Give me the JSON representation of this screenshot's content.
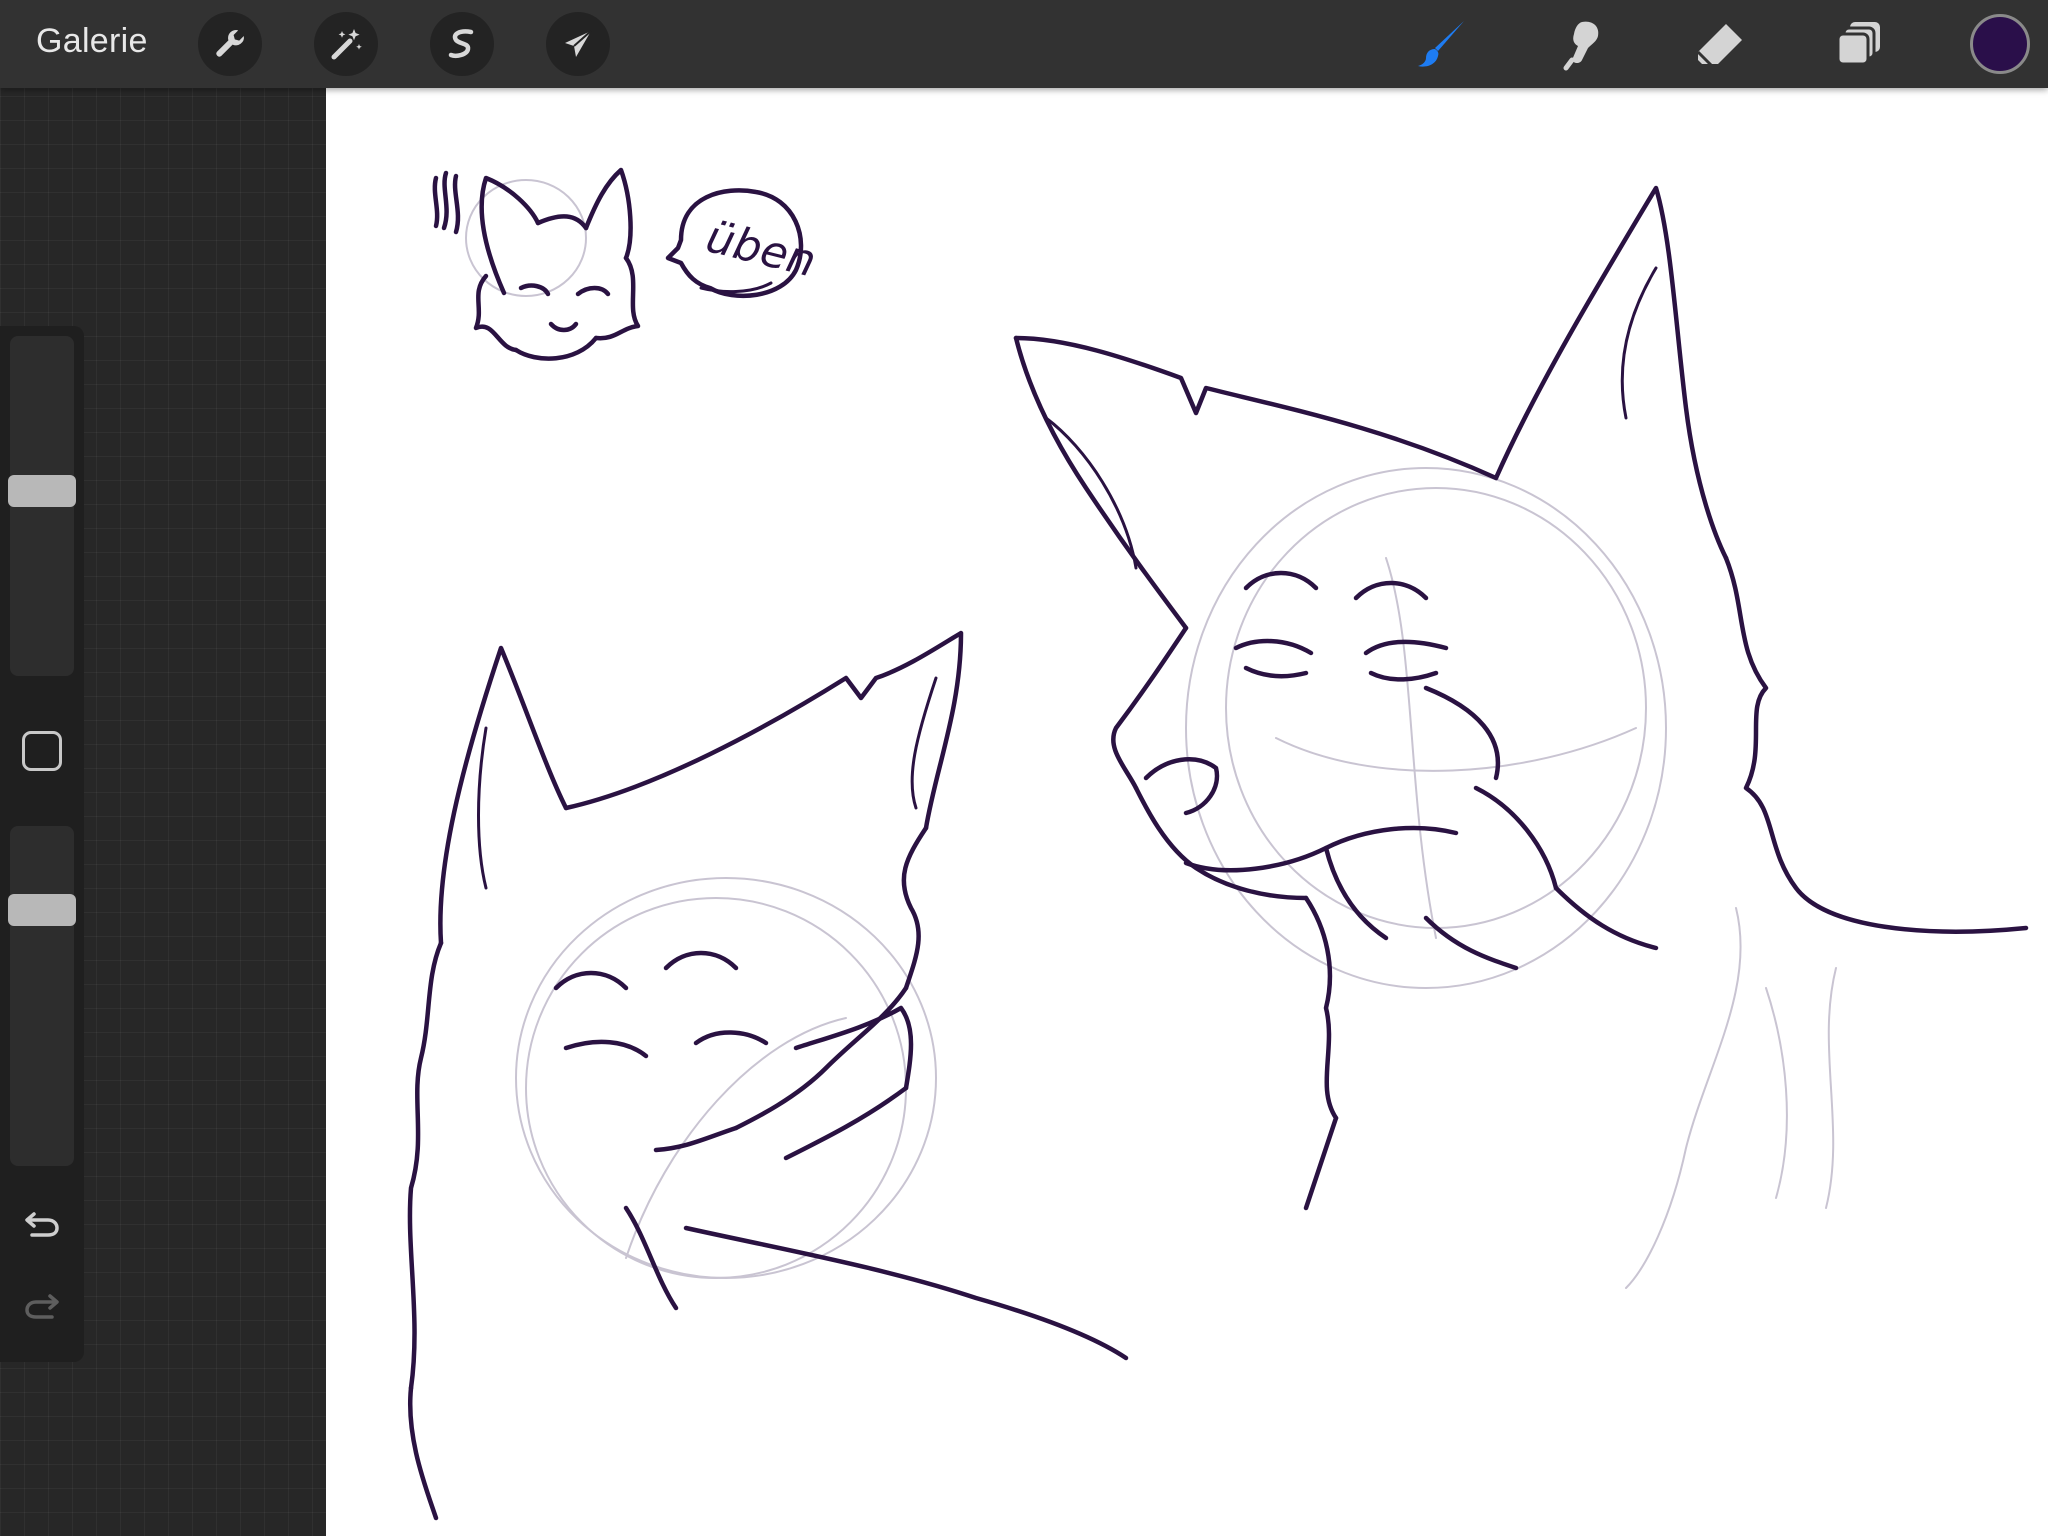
{
  "toolbar": {
    "gallery_label": "Galerie",
    "left_tools": [
      {
        "name": "actions",
        "icon": "wrench-icon"
      },
      {
        "name": "adjustments",
        "icon": "magic-wand-icon"
      },
      {
        "name": "selection",
        "icon": "selection-s-icon"
      },
      {
        "name": "transform",
        "icon": "arrow-cursor-icon"
      }
    ],
    "right_tools": [
      {
        "name": "brush",
        "icon": "brush-icon",
        "active": true
      },
      {
        "name": "smudge",
        "icon": "smudge-finger-icon",
        "active": false
      },
      {
        "name": "eraser",
        "icon": "eraser-icon",
        "active": false
      },
      {
        "name": "layers",
        "icon": "layers-icon",
        "active": false
      }
    ],
    "current_color": "#2a0f4a",
    "active_tool_color": "#1e7cf2"
  },
  "sidebar": {
    "brush_size_level": 0.55,
    "brush_opacity_level": 0.78,
    "modifier_icon": "square-modifier-icon",
    "undo_icon": "undo-icon",
    "redo_icon": "redo-icon"
  },
  "canvas": {
    "speech_bubble_text": "üben",
    "ink_color": "#2a1242",
    "sketch_color": "#c9c4d2"
  }
}
